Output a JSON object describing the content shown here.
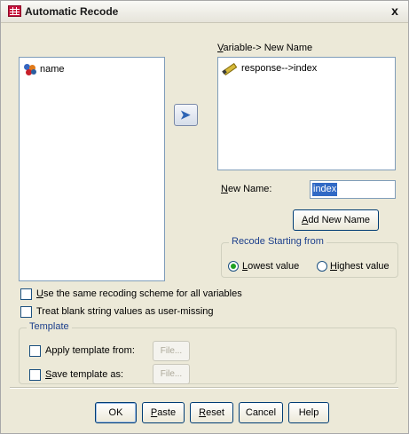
{
  "window": {
    "title": "Automatic Recode",
    "close_glyph": "x"
  },
  "source_list": {
    "items": [
      {
        "label": "name",
        "icon": "nominal-variable-icon"
      }
    ]
  },
  "move_button": {
    "icon": "right-arrow-icon"
  },
  "target": {
    "header_prefix": "",
    "header_underline": "V",
    "header_rest": "ariable-> New Name",
    "items": [
      {
        "label": "response-->index",
        "icon": "scale-variable-icon"
      }
    ]
  },
  "new_name": {
    "label_underline": "N",
    "label_rest": "ew Name:",
    "value": "index"
  },
  "add_new_name": {
    "underline": "A",
    "rest": "dd New Name"
  },
  "recode_group": {
    "legend": "Recode Starting from",
    "lowest": {
      "underline": "L",
      "rest": "owest value",
      "checked": true
    },
    "highest": {
      "underline": "H",
      "rest": "ighest value",
      "checked": false
    }
  },
  "options": {
    "same_scheme": {
      "underline": "U",
      "rest": "se the same recoding scheme for all variables",
      "checked": false
    },
    "blank_missing": {
      "underline": "",
      "rest": "Treat blank string values as user-missing",
      "checked": false
    }
  },
  "template_group": {
    "legend": "Template",
    "apply": {
      "label": "Apply template from:",
      "checked": false,
      "file_label": "File..."
    },
    "save": {
      "underline": "S",
      "rest": "ave template as:",
      "checked": false,
      "file_label": "File..."
    }
  },
  "buttons": {
    "ok": "OK",
    "paste": {
      "underline": "P",
      "rest": "aste"
    },
    "reset": {
      "underline": "R",
      "rest": "eset"
    },
    "cancel": "Cancel",
    "help": "Help"
  }
}
